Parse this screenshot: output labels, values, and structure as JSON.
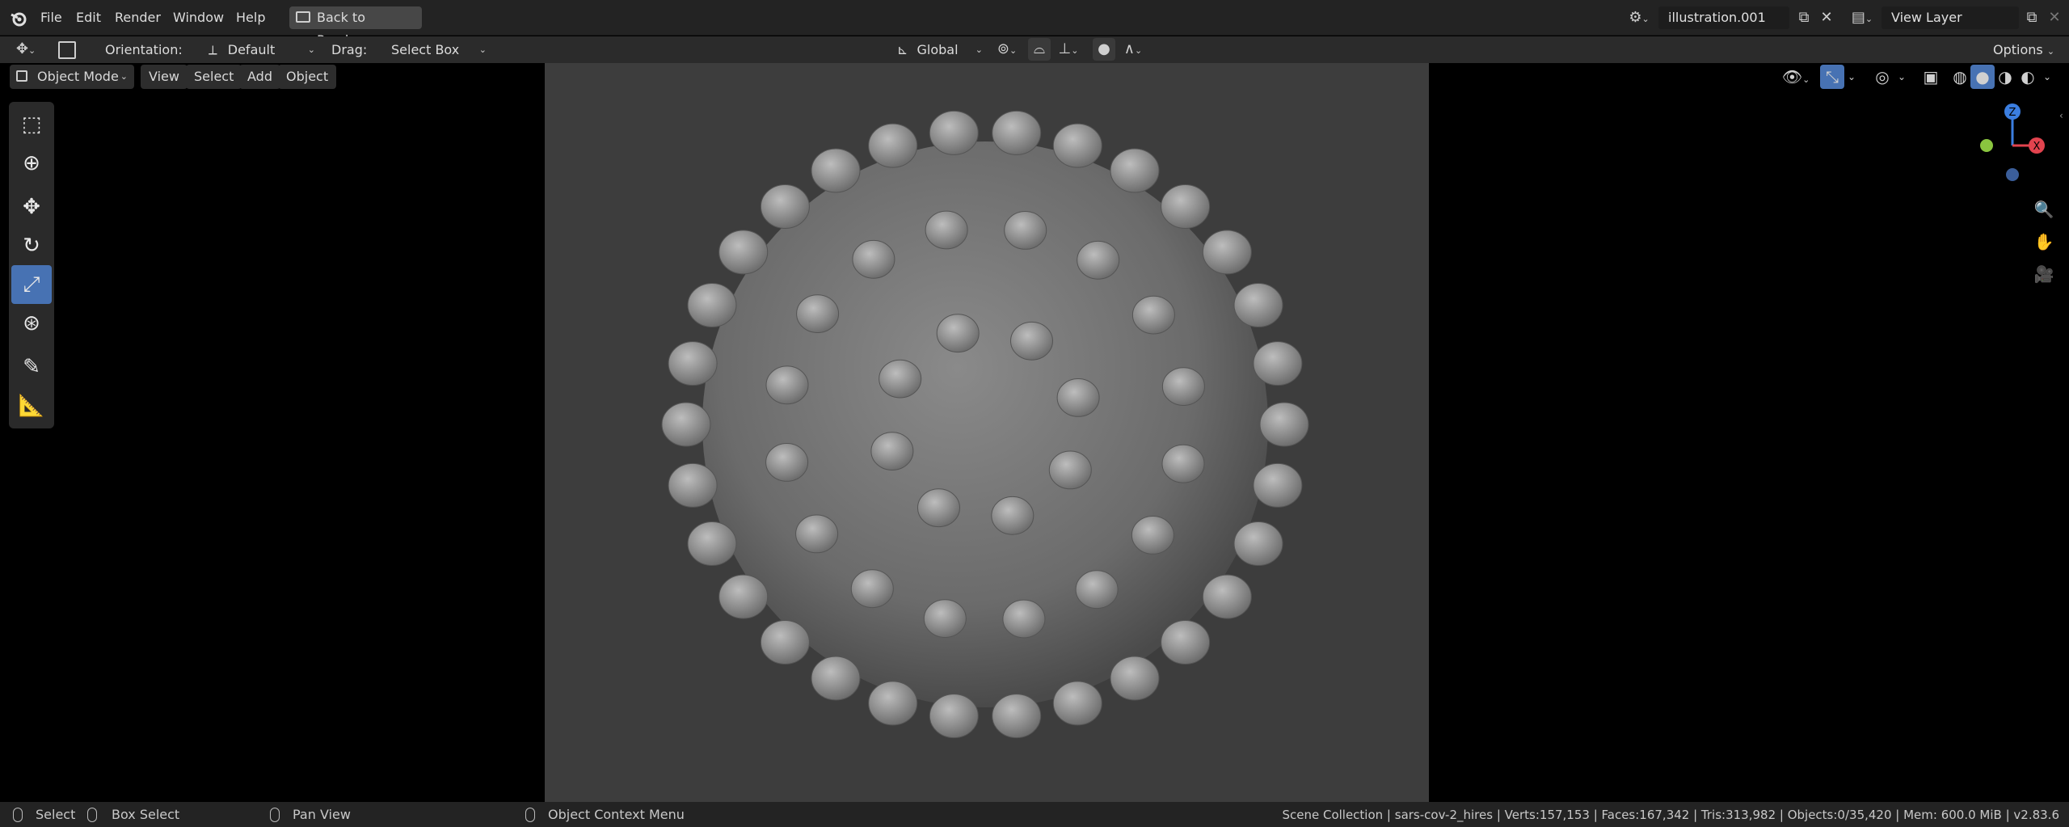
{
  "menubar": {
    "items": [
      "File",
      "Edit",
      "Render",
      "Window",
      "Help"
    ],
    "back_button": "Back to Previous"
  },
  "scene_selector": {
    "value": "illustration.001"
  },
  "view_layer_selector": {
    "value": "View Layer"
  },
  "tool_header": {
    "orientation_label": "Orientation:",
    "orientation_value": "Default",
    "drag_label": "Drag:",
    "drag_value": "Select Box",
    "transform_orientation": "Global",
    "options_label": "Options"
  },
  "viewport_header": {
    "mode": "Object Mode",
    "menus": [
      "View",
      "Select",
      "Add",
      "Object"
    ]
  },
  "gizmo": {
    "z_label": "Z",
    "x_label": "X"
  },
  "statusbar": {
    "select": "Select",
    "box_select": "Box Select",
    "pan_view": "Pan View",
    "context_menu": "Object Context Menu",
    "stats": "Scene Collection | sars-cov-2_hires | Verts:157,153 | Faces:167,342 | Tris:313,982 | Objects:0/35,420 | Mem: 600.0 MiB | v2.83.6"
  },
  "colors": {
    "accent": "#4772b3",
    "gizmo_x": "#e2434e",
    "gizmo_y": "#8ac53f",
    "gizmo_z": "#3b7ee0",
    "viewport_bg": "#3d3d3d"
  },
  "icons": [
    "blender-logo-icon",
    "screen-icon",
    "select-box-icon",
    "cursor-icon",
    "move-icon",
    "rotate-icon",
    "scale-icon",
    "transform-icon",
    "annotate-icon",
    "measure-icon",
    "zoom-icon",
    "hand-icon",
    "camera-icon"
  ]
}
